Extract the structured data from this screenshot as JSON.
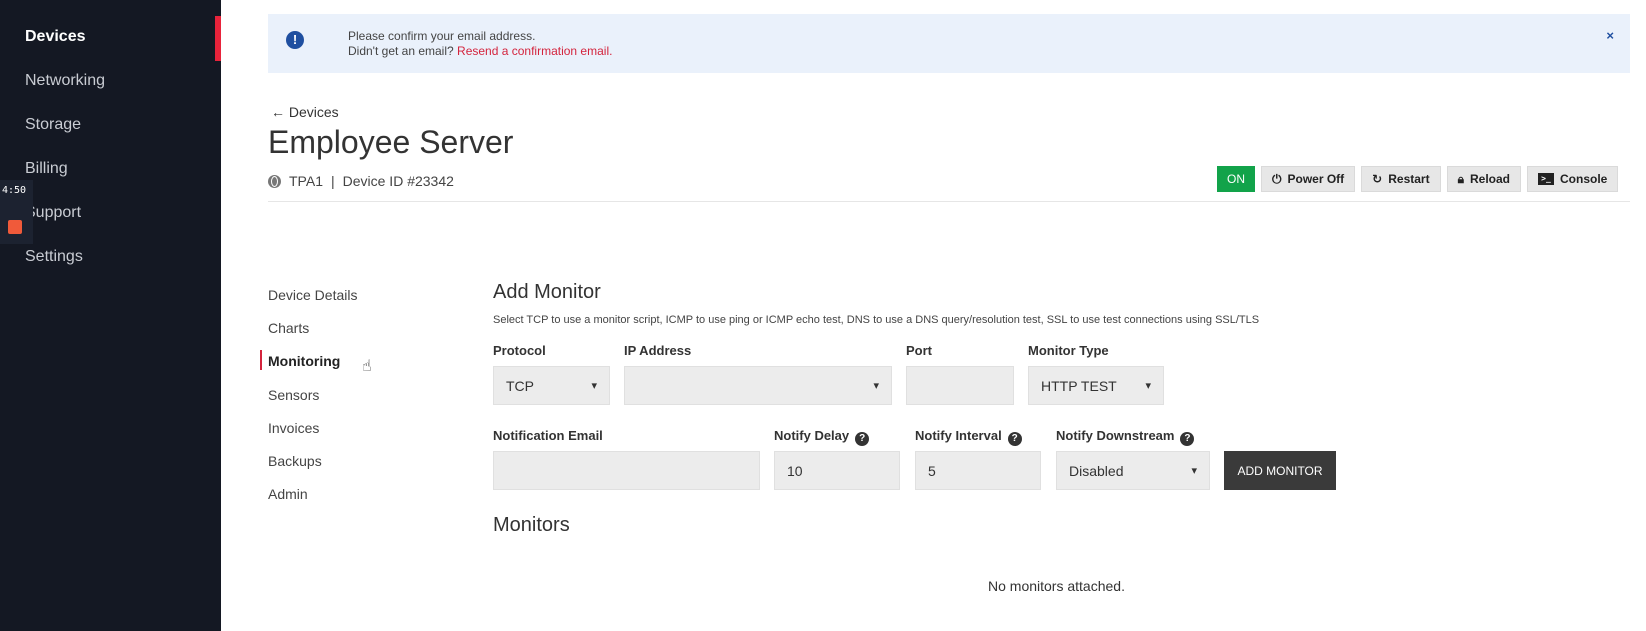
{
  "sidebar": {
    "items": [
      {
        "label": "Devices",
        "active": true
      },
      {
        "label": "Networking"
      },
      {
        "label": "Storage"
      },
      {
        "label": "Billing"
      },
      {
        "label": "Support"
      },
      {
        "label": "Settings"
      }
    ],
    "timer": "4:50",
    "accent_color": "#e8233b"
  },
  "alert": {
    "line1": "Please confirm your email address.",
    "line2_prefix": "Didn't get an email?",
    "link_text": "Resend a confirmation email.",
    "icon": "info-icon",
    "close": "×"
  },
  "header": {
    "back_label": "← Devices",
    "title": "Employee Server",
    "location": "TPA1",
    "separator": "|",
    "device_id": "Device ID #23342"
  },
  "actions": {
    "status": "ON",
    "power_off": "Power Off",
    "restart": "Restart",
    "reload": "Reload",
    "console": "Console",
    "status_color": "#12a34a"
  },
  "subnav": {
    "items": [
      {
        "label": "Device Details"
      },
      {
        "label": "Charts"
      },
      {
        "label": "Monitoring",
        "active": true
      },
      {
        "label": "Sensors"
      },
      {
        "label": "Invoices"
      },
      {
        "label": "Backups"
      },
      {
        "label": "Admin"
      }
    ]
  },
  "add_monitor": {
    "title": "Add Monitor",
    "description": "Select TCP to use a monitor script, ICMP to use ping or ICMP echo test, DNS to use a DNS query/resolution test, SSL to use test connections using SSL/TLS",
    "protocol": {
      "label": "Protocol",
      "value": "TCP"
    },
    "ip_address": {
      "label": "IP Address",
      "value": ""
    },
    "port": {
      "label": "Port",
      "value": ""
    },
    "monitor_type": {
      "label": "Monitor Type",
      "value": "HTTP TEST"
    },
    "notification_email": {
      "label": "Notification Email",
      "value": ""
    },
    "notify_delay": {
      "label": "Notify Delay",
      "value": "10"
    },
    "notify_interval": {
      "label": "Notify Interval",
      "value": "5"
    },
    "notify_downstream": {
      "label": "Notify Downstream",
      "value": "Disabled"
    },
    "help_glyph": "?",
    "submit_label": "ADD MONITOR"
  },
  "monitors": {
    "title": "Monitors",
    "empty_text": "No monitors attached."
  }
}
